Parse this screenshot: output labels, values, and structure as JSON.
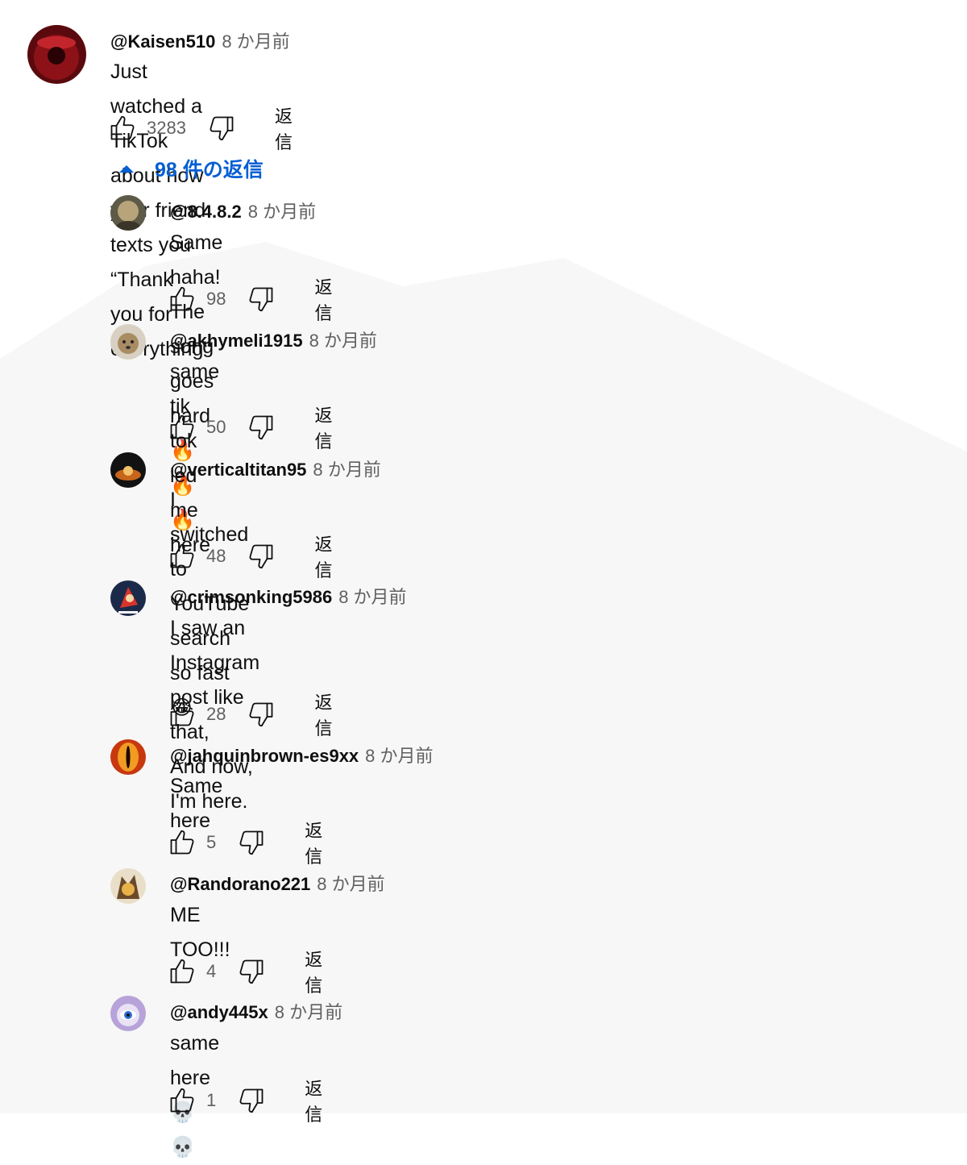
{
  "top_comment": {
    "author": "@Kaisen510",
    "time": "8 か月前",
    "text": "Just watched a TikTok about how your friend texts you “Thank you for everything”",
    "likes": "3283",
    "reply_label": "返信",
    "avatar_color": "#7a0d12"
  },
  "replies_toggle": {
    "label": "98 件の返信",
    "expanded": true,
    "color": "#065fd4"
  },
  "replies": [
    {
      "author": "@8.4.8.2",
      "time": "8 か月前",
      "text": "Same haha! The song goes hard 🔥 🔥 🔥",
      "likes": "98",
      "reply_label": "返信",
      "avatar_color": "#8a7a55"
    },
    {
      "author": "@akhymeli1915",
      "time": "8 か月前",
      "text": "same tik tok led me here",
      "likes": "50",
      "reply_label": "返信",
      "avatar_color": "#c9b59a"
    },
    {
      "author": "@verticaltitan95",
      "time": "8 か月前",
      "text": "I switched to YouTube search so fast😂",
      "likes": "48",
      "reply_label": "返信",
      "avatar_color": "#1a1a1a"
    },
    {
      "author": "@crimsonking5986",
      "time": "8 か月前",
      "text": "I saw an Instagram post like that,\nAnd now, I'm here.",
      "likes": "28",
      "reply_label": "返信",
      "avatar_color": "#1c2a4a"
    },
    {
      "author": "@jahquinbrown-es9xx",
      "time": "8 か月前",
      "text": "Same here",
      "likes": "5",
      "reply_label": "返信",
      "avatar_color": "#c8380e"
    },
    {
      "author": "@Randorano221",
      "time": "8 か月前",
      "text": "ME TOO!!!",
      "likes": "4",
      "reply_label": "返信",
      "avatar_color": "#6b4a2a"
    },
    {
      "author": "@andy445x",
      "time": "8 か月前",
      "text": "same here 💀 💀",
      "likes": "1",
      "reply_label": "返信",
      "avatar_color": "#b7a3d9"
    }
  ],
  "colors": {
    "text": "#0f0f0f",
    "secondary": "#606060",
    "link": "#065fd4",
    "background": "#ffffff"
  }
}
